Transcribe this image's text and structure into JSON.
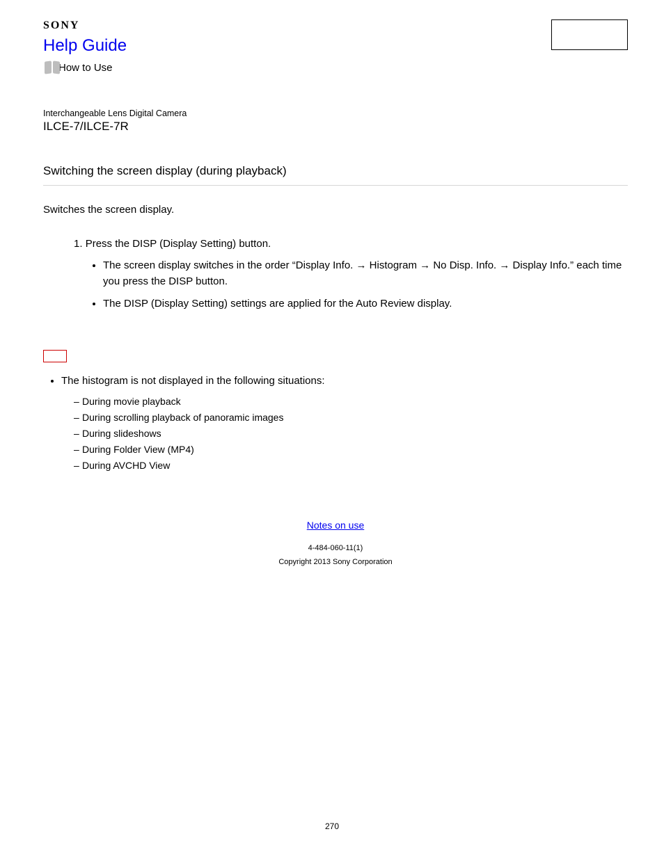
{
  "header": {
    "brand": "SONY",
    "help_guide": "Help Guide",
    "how_to_use": "How to Use"
  },
  "product": {
    "type": "Interchangeable Lens Digital Camera",
    "model": "ILCE-7/ILCE-7R"
  },
  "title": "Switching the screen display (during playback)",
  "intro": "Switches the screen display.",
  "step": {
    "number": "1.",
    "text": "Press the DISP (Display Setting) button.",
    "bullets": [
      "The screen display switches in the order “Display Info. → Histogram → No Disp. Info. → Display Info.” each time you press the DISP button.",
      "The DISP (Display Setting) settings are applied for the Auto Review display."
    ]
  },
  "note": {
    "lead": "The histogram is not displayed in the following situations:",
    "items": [
      "During movie playback",
      "During scrolling playback of panoramic images",
      "During slideshows",
      "During Folder View (MP4)",
      "During AVCHD View"
    ]
  },
  "footer": {
    "notes_link": "Notes on use",
    "pub_code": "4-484-060-11(1)",
    "copyright": "Copyright 2013 Sony Corporation"
  },
  "page_number": "270"
}
